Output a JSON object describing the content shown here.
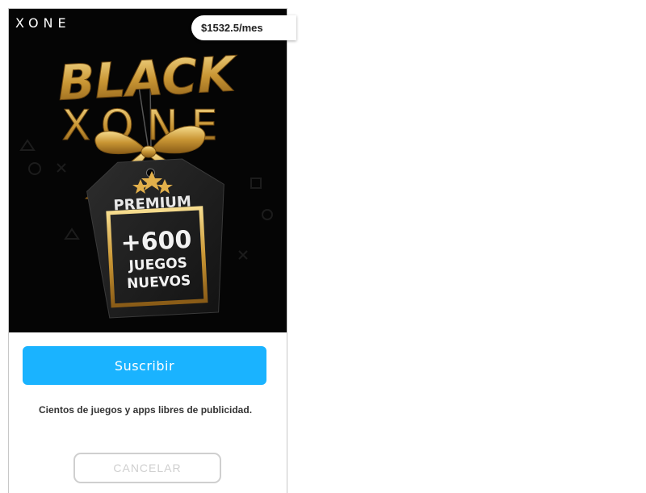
{
  "app": {
    "brand": "XONE"
  },
  "offer": {
    "price": "$1532.5/mes"
  },
  "banner": {
    "line1": "BLACK",
    "line2": "XONE",
    "tag_label": "PREMIUM",
    "tag_count": "+600",
    "tag_line1": "JUEGOS",
    "tag_line2": "NUEVOS"
  },
  "actions": {
    "subscribe_label": "Suscribir",
    "description": "Cientos de juegos y apps libres de publicidad.",
    "cancel_label": "CANCELAR"
  },
  "colors": {
    "accent": "#1ab3ff",
    "gold": "#d9a441",
    "banner_bg": "#050505"
  }
}
